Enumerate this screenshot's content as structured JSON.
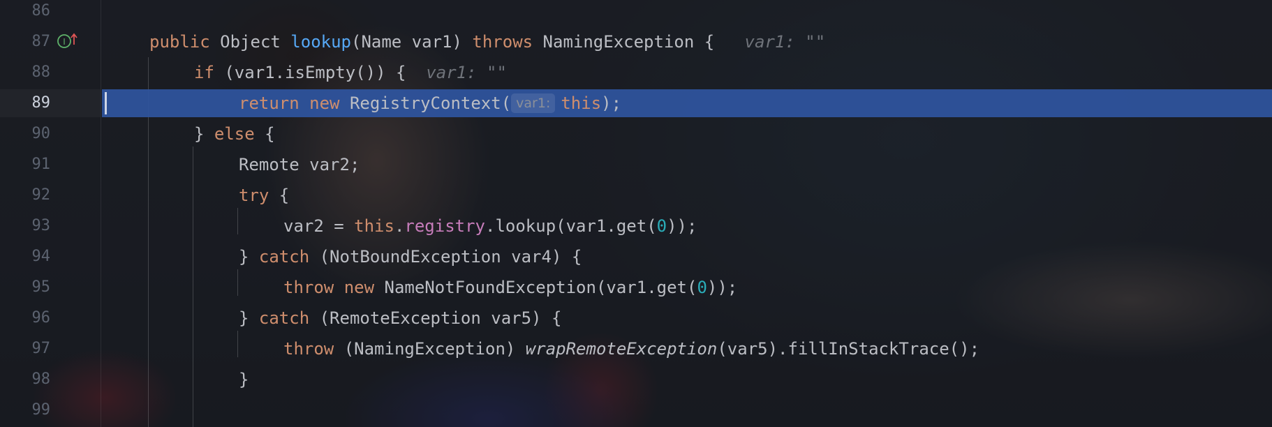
{
  "gutter": {
    "line_numbers": [
      "86",
      "87",
      "88",
      "89",
      "90",
      "91",
      "92",
      "93",
      "94",
      "95",
      "96",
      "97",
      "98",
      "99"
    ],
    "icon": "implements-up-arrow-icon"
  },
  "code": {
    "l87": {
      "kw_public": "public",
      "type": " Object ",
      "method": "lookup",
      "params": "(Name var1) ",
      "kw_throws": "throws",
      "rest": " NamingException {",
      "hint": "var1: \"\""
    },
    "l88": {
      "kw_if": "if",
      "rest": " (var1.isEmpty()) {",
      "hint": "var1: \"\""
    },
    "l89": {
      "kw_return": "return",
      "kw_new": "new",
      "ctor": " RegistryContext(",
      "param_hint": "var1:",
      "kw_this": "this",
      "rest": ");"
    },
    "l90": {
      "brace": "} ",
      "kw_else": "else",
      "rest": " {"
    },
    "l91": {
      "text": "Remote var2;"
    },
    "l92": {
      "kw_try": "try",
      "rest": " {"
    },
    "l93": {
      "pre": "var2 = ",
      "kw_this": "this",
      "dot": ".",
      "field": "registry",
      "mid": ".lookup(var1.get(",
      "num": "0",
      "end": "));"
    },
    "l94": {
      "brace": "} ",
      "kw_catch": "catch",
      "rest": " (NotBoundException var4) {"
    },
    "l95": {
      "kw_throw": "throw",
      "kw_new": "new",
      "mid": " NameNotFoundException(var1.get(",
      "num": "0",
      "end": "));"
    },
    "l96": {
      "brace": "} ",
      "kw_catch": "catch",
      "rest": " (RemoteException var5) {"
    },
    "l97": {
      "kw_throw": "throw",
      "cast": " (NamingException) ",
      "static_call": "wrapRemoteException",
      "rest": "(var5).fillInStackTrace();"
    },
    "l98": {
      "brace": "}"
    }
  },
  "colors": {
    "keyword": "#cf8e6d",
    "method": "#56a8f5",
    "field": "#c77dbb",
    "number": "#2aacb8",
    "text": "#bcbec4",
    "current_line": "#2f55a0"
  }
}
